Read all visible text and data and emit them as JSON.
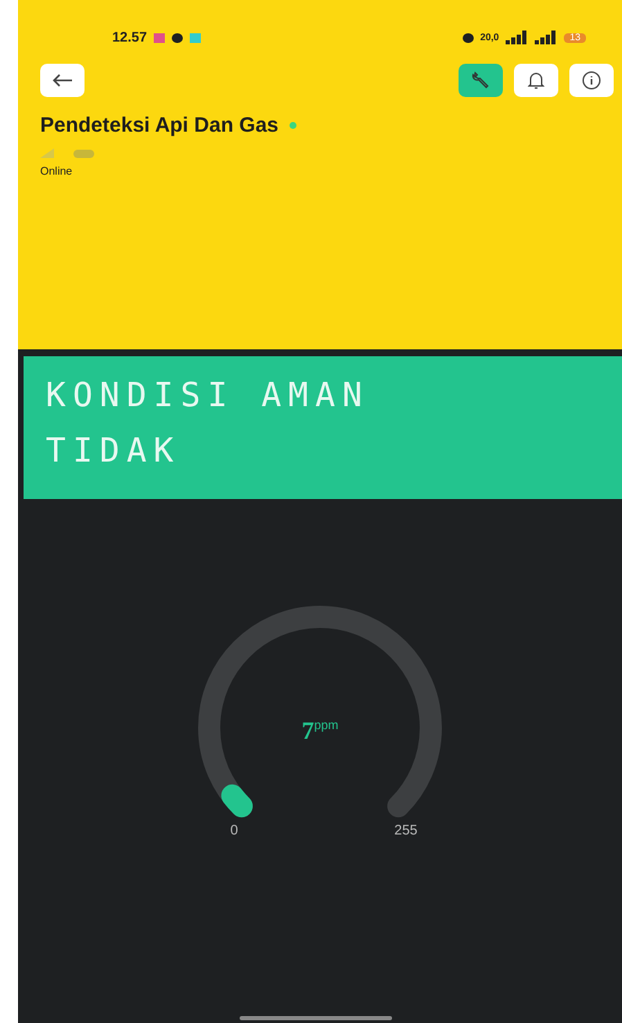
{
  "status_bar": {
    "time": "12.57",
    "network_speed": "20,0",
    "battery": "13"
  },
  "header": {
    "title": "Pendeteksi Api Dan Gas",
    "online_dot": true,
    "status": "Online",
    "settings_selected": true
  },
  "lcd": {
    "lines": [
      "KONDISI AMAN",
      "TIDAK"
    ]
  },
  "gauge": {
    "value": "7",
    "unit": "ppm",
    "min": "0",
    "max": "255"
  }
}
